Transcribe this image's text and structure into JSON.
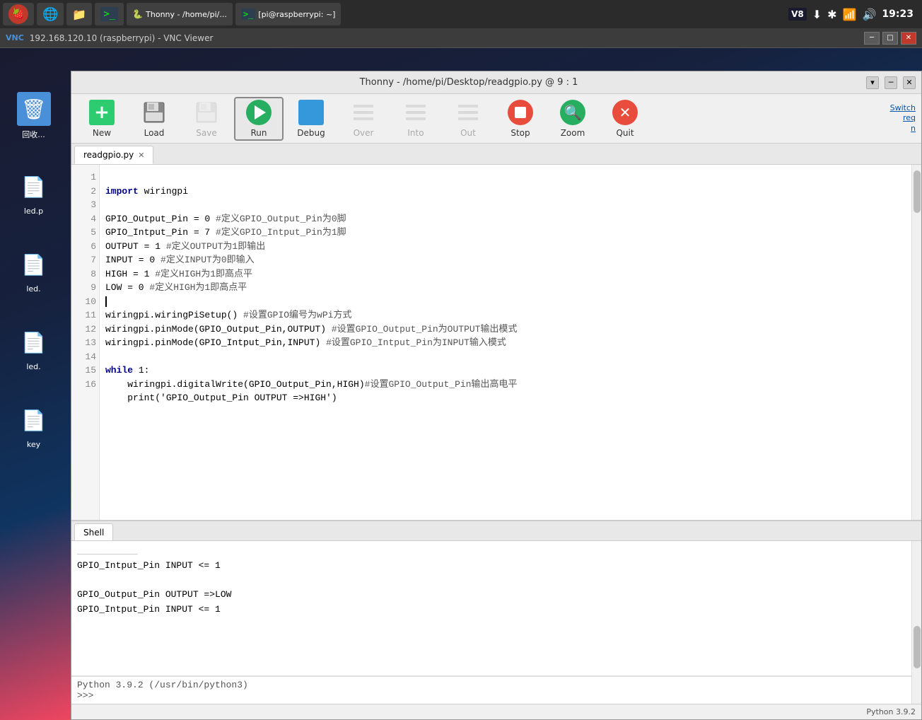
{
  "desktop": {
    "background": "sunset"
  },
  "taskbar": {
    "left_items": [
      {
        "id": "raspi",
        "label": "Raspberry Pi",
        "icon": "raspberry-icon"
      },
      {
        "id": "browser",
        "label": "Browser",
        "icon": "globe-icon"
      },
      {
        "id": "files",
        "label": "File Manager",
        "icon": "folder-icon"
      },
      {
        "id": "terminal",
        "label": "Terminal",
        "icon": "terminal-icon"
      },
      {
        "id": "thonny",
        "label": "Thonny - /home/pi/...",
        "icon": "thonny-icon"
      },
      {
        "id": "pi-terminal",
        "label": "[pi@raspberrypi: ~]",
        "icon": "terminal2-icon"
      }
    ],
    "right": {
      "v8_icon": "V8",
      "download_icon": "download",
      "bluetooth_icon": "bluetooth",
      "wifi_icon": "wifi",
      "volume_icon": "volume",
      "time": "19:23"
    }
  },
  "vnc": {
    "title": "192.168.120.10 (raspberrypi) - VNC Viewer",
    "controls": [
      "minimize",
      "maximize",
      "close"
    ]
  },
  "thonny": {
    "title": "Thonny - /home/pi/Desktop/readgpio.py @ 9 : 1",
    "title_controls": [
      "dropdown",
      "minimize",
      "close"
    ],
    "toolbar": {
      "new_label": "New",
      "load_label": "Load",
      "save_label": "Save",
      "run_label": "Run",
      "debug_label": "Debug",
      "over_label": "Over",
      "into_label": "Into",
      "out_label": "Out",
      "stop_label": "Stop",
      "zoom_label": "Zoom",
      "quit_label": "Quit",
      "switch_label": "Switch\nreq\nn"
    },
    "tab": {
      "filename": "readgpio.py",
      "closeable": true
    },
    "code": {
      "lines": [
        {
          "num": 1,
          "text": "import wiringpi"
        },
        {
          "num": 2,
          "text": ""
        },
        {
          "num": 3,
          "text": "GPIO_Output_Pin = 0 #定义GPIO_Output_Pin为0脚"
        },
        {
          "num": 4,
          "text": "GPIO_Intput_Pin = 7 #定义GPIO_Intput_Pin为1脚"
        },
        {
          "num": 5,
          "text": "OUTPUT = 1 #定义OUTPUT为1即输出"
        },
        {
          "num": 6,
          "text": "INPUT = 0 #定义INPUT为0即输入"
        },
        {
          "num": 7,
          "text": "HIGH = 1 #定义HIGH为1即高点平"
        },
        {
          "num": 8,
          "text": "LOW = 0 #定义HIGH为1即高点平"
        },
        {
          "num": 9,
          "text": ""
        },
        {
          "num": 10,
          "text": "wiringpi.wiringPiSetup() #设置GPIO编号为wPi方式"
        },
        {
          "num": 11,
          "text": "wiringpi.pinMode(GPIO_Output_Pin,OUTPUT) #设置GPIO_Output_Pin为OUTPUT输出模式"
        },
        {
          "num": 12,
          "text": "wiringpi.pinMode(GPIO_Intput_Pin,INPUT) #设置GPIO_Intput_Pin为INPUT输入模式"
        },
        {
          "num": 13,
          "text": ""
        },
        {
          "num": 14,
          "text": "while 1:"
        },
        {
          "num": 15,
          "text": "    wiringpi.digitalWrite(GPIO_Output_Pin,HIGH)#设置GPIO_Output_Pin输出高电平"
        },
        {
          "num": 16,
          "text": "    print('GPIO_Output_Pin OUTPUT =>HIGH')"
        }
      ]
    },
    "shell": {
      "tab_label": "Shell",
      "output": [
        "GPIO_Intput_Pin INPUT <= 1",
        "",
        "GPIO_Output_Pin OUTPUT =>LOW",
        "GPIO_Intput_Pin INPUT <= 1"
      ],
      "python_version": "Python 3.9.2 (/usr/bin/python3)",
      "prompt": ">>>"
    },
    "status": {
      "text": "Python 3.9.2"
    }
  },
  "desktop_icons": [
    {
      "id": "trash",
      "label": "回收...",
      "type": "trash"
    },
    {
      "id": "led1",
      "label": "led.p",
      "type": "file"
    },
    {
      "id": "led2",
      "label": "led.",
      "type": "file"
    },
    {
      "id": "led3",
      "label": "led.",
      "type": "file"
    },
    {
      "id": "key",
      "label": "key",
      "type": "file"
    }
  ]
}
